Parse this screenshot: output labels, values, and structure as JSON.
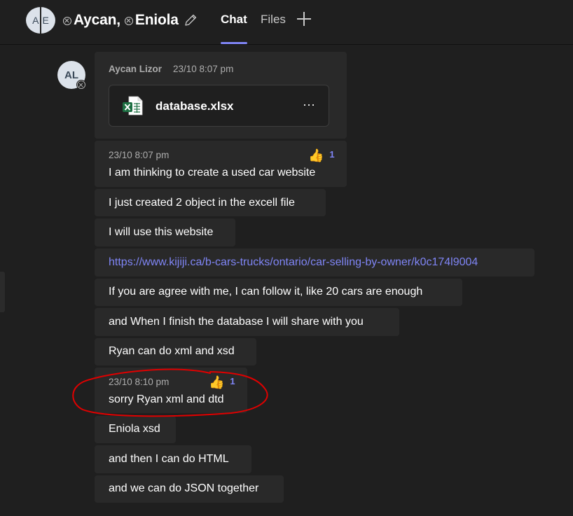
{
  "header": {
    "group_avatar_initials": [
      "A",
      "E"
    ],
    "participants": [
      {
        "name": "Aycan,",
        "status_icon": "offline-x-icon"
      },
      {
        "name": "Eniola",
        "status_icon": "offline-x-icon"
      }
    ],
    "edit_icon": "pencil-icon",
    "tabs": [
      {
        "label": "Chat",
        "active": true
      },
      {
        "label": "Files",
        "active": false
      }
    ],
    "add_tab_icon": "plus-icon"
  },
  "sender": {
    "initials": "AL",
    "name": "Aycan Lizor",
    "time": "23/10 8:07 pm"
  },
  "attachment": {
    "file_name": "database.xlsx",
    "icon": "excel-file-icon",
    "more": "···"
  },
  "messages": [
    {
      "time": "23/10 8:07 pm",
      "text": "I am thinking to create a used car website",
      "reaction": {
        "emoji": "👍",
        "count": "1"
      }
    },
    {
      "text": "I just created 2 object in the excell file"
    },
    {
      "text": "I will use this website"
    },
    {
      "text": "https://www.kijiji.ca/b-cars-trucks/ontario/car-selling-by-owner/k0c174l9004",
      "is_link": true
    },
    {
      "text": "If you are agree with me, I can follow it, like 20 cars are enough"
    },
    {
      "text": "and When I finish the database I will share with you"
    },
    {
      "text": "Ryan can do xml and xsd"
    },
    {
      "time": "23/10 8:10 pm",
      "text": "sorry Ryan xml and dtd",
      "reaction": {
        "emoji": "👍",
        "count": "1"
      },
      "annotated": true
    },
    {
      "text": "Eniola xsd"
    },
    {
      "text": "and then I can do HTML"
    },
    {
      "text": "and we can do JSON together"
    }
  ],
  "colors": {
    "background": "#1f1f1f",
    "bubble": "#292929",
    "accent": "#7f85f5",
    "muted_text": "#adadad",
    "annotation": "#e00000"
  }
}
